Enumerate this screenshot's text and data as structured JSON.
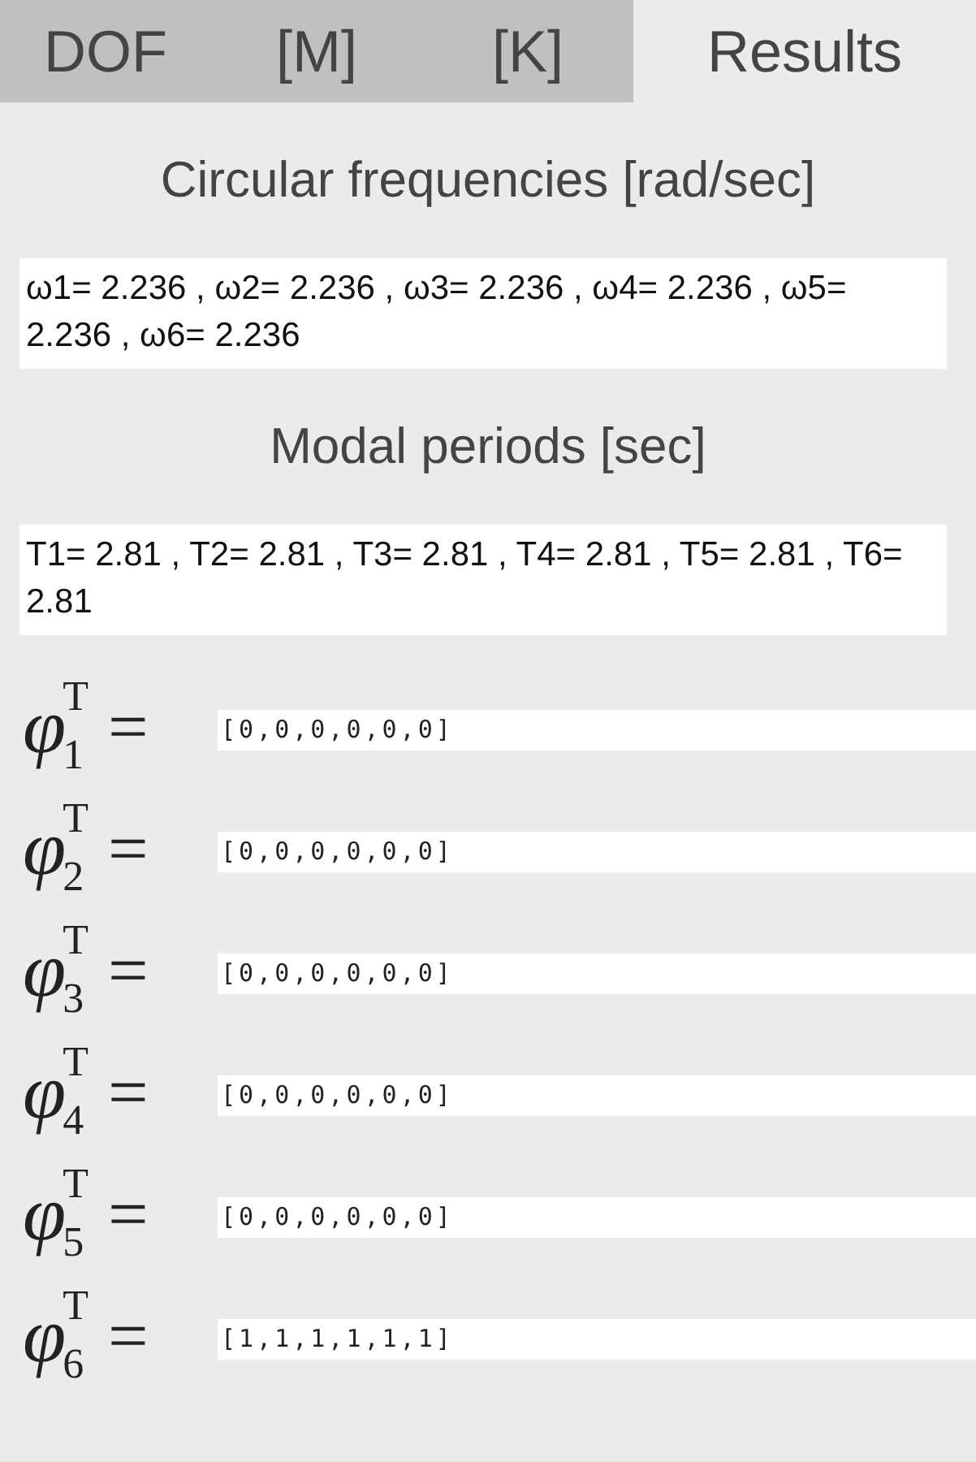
{
  "tabs": [
    {
      "label": "DOF",
      "selected": false
    },
    {
      "label": "[M]",
      "selected": false
    },
    {
      "label": "[K]",
      "selected": false
    },
    {
      "label": "Results",
      "selected": true
    }
  ],
  "sections": [
    {
      "heading": "Circular frequencies [rad/sec]",
      "value": "ω1= 2.236 , ω2= 2.236 , ω3= 2.236 , ω4= 2.236 , ω5= 2.236 , ω6= 2.236"
    },
    {
      "heading": "Modal periods [sec]",
      "value": "T1= 2.81 , T2= 2.81 , T3= 2.81 , T4= 2.81 , T5= 2.81 , T6= 2.81"
    }
  ],
  "mode_shapes": [
    {
      "symbol": "φ",
      "index": "1",
      "superscript": "T",
      "equals": "=",
      "value": "[0,0,0,0,0,0]"
    },
    {
      "symbol": "φ",
      "index": "2",
      "superscript": "T",
      "equals": "=",
      "value": "[0,0,0,0,0,0]"
    },
    {
      "symbol": "φ",
      "index": "3",
      "superscript": "T",
      "equals": "=",
      "value": "[0,0,0,0,0,0]"
    },
    {
      "symbol": "φ",
      "index": "4",
      "superscript": "T",
      "equals": "=",
      "value": "[0,0,0,0,0,0]"
    },
    {
      "symbol": "φ",
      "index": "5",
      "superscript": "T",
      "equals": "=",
      "value": "[0,0,0,0,0,0]"
    },
    {
      "symbol": "φ",
      "index": "6",
      "superscript": "T",
      "equals": "=",
      "value": "[1,1,1,1,1,1]"
    }
  ]
}
